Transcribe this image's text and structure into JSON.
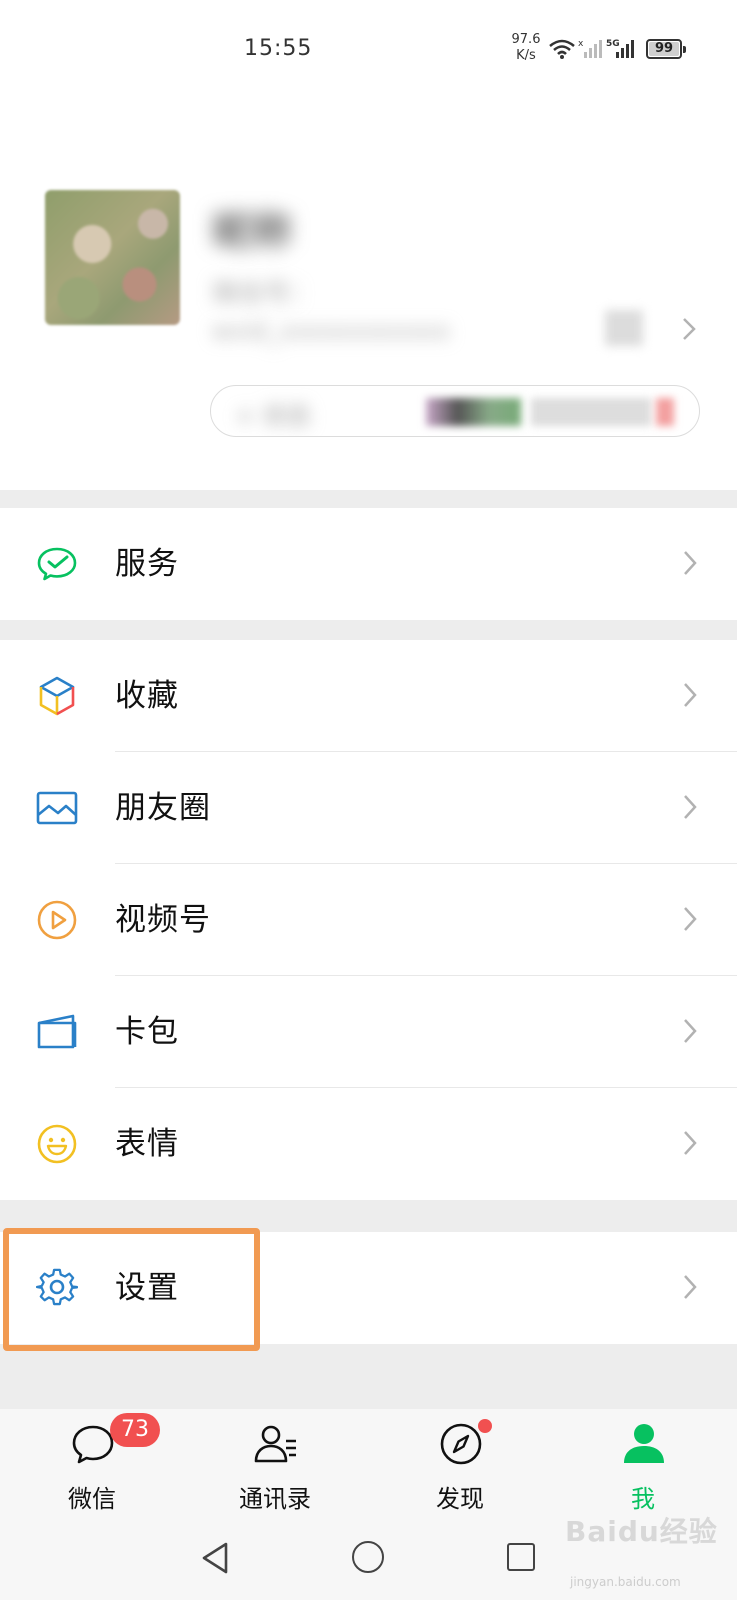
{
  "status_bar": {
    "time": "15:55",
    "net_speed_value": "97.6",
    "net_speed_unit": "K/s",
    "battery": "99",
    "battery_level": 0.99,
    "network_type": "5G"
  },
  "profile": {
    "nickname": "昵称",
    "wechat_id_label": "微信号：",
    "wechat_id": "wxid_xxxxxxxxxxxx",
    "status_text": "+ 状态"
  },
  "menu": {
    "services": {
      "label": "服务",
      "icon": "wechat-pay-icon",
      "color": "#07c160"
    },
    "favorites": {
      "label": "收藏",
      "icon": "cube-icon"
    },
    "moments": {
      "label": "朋友圈",
      "icon": "image-icon",
      "color": "#2a80c8"
    },
    "channels": {
      "label": "视频号",
      "icon": "play-icon",
      "color": "#f0a040"
    },
    "cards": {
      "label": "卡包",
      "icon": "card-icon",
      "color": "#2a80c8"
    },
    "stickers": {
      "label": "表情",
      "icon": "smile-icon",
      "color": "#f2c022"
    },
    "settings": {
      "label": "设置",
      "icon": "gear-icon",
      "color": "#2a80c8"
    }
  },
  "highlight_color": "#f19a52",
  "tabs": [
    {
      "label": "微信",
      "icon": "chat-icon",
      "badge": "73"
    },
    {
      "label": "通讯录",
      "icon": "contacts-icon"
    },
    {
      "label": "发现",
      "icon": "compass-icon"
    },
    {
      "label": "我",
      "icon": "me-icon",
      "active": true,
      "active_color": "#07c160"
    }
  ],
  "watermark": {
    "brand": "Baidu经验",
    "url": "jingyan.baidu.com"
  }
}
